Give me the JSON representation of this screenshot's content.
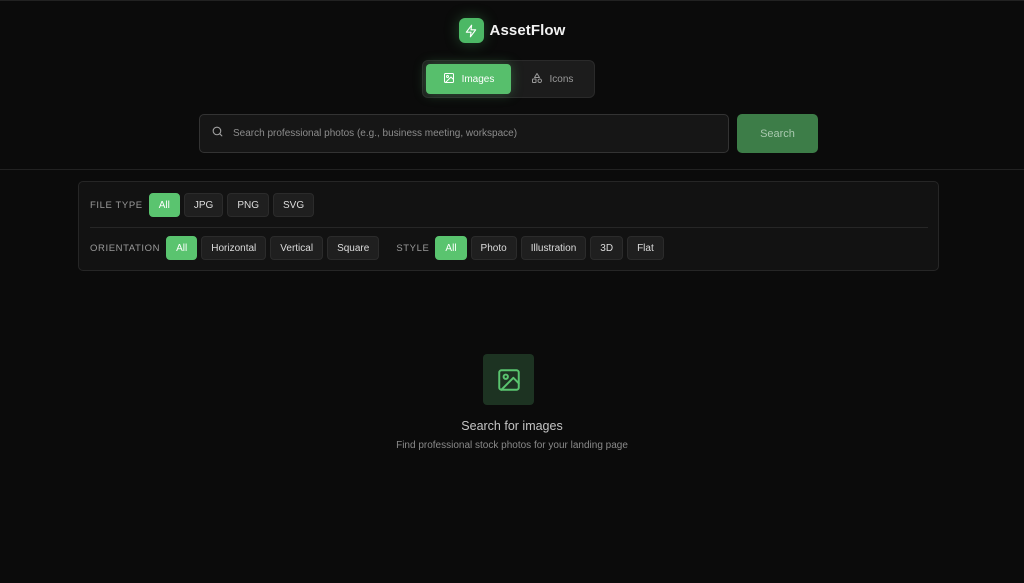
{
  "brand": {
    "name": "AssetFlow",
    "logo_icon": "lightning-icon",
    "accent": "#4cb865"
  },
  "mode_tabs": [
    {
      "label": "Images",
      "icon": "image-icon",
      "active": true
    },
    {
      "label": "Icons",
      "icon": "shapes-icon",
      "active": false
    }
  ],
  "search": {
    "placeholder": "Search professional photos (e.g., business meeting, workspace)",
    "value": "",
    "button_label": "Search",
    "icon": "search-icon"
  },
  "filters": {
    "file_type": {
      "label": "FILE TYPE",
      "options": [
        "All",
        "JPG",
        "PNG",
        "SVG"
      ],
      "selected": "All"
    },
    "orientation": {
      "label": "ORIENTATION",
      "options": [
        "All",
        "Horizontal",
        "Vertical",
        "Square"
      ],
      "selected": "All"
    },
    "style": {
      "label": "STYLE",
      "options": [
        "All",
        "Photo",
        "Illustration",
        "3D",
        "Flat"
      ],
      "selected": "All"
    }
  },
  "empty_state": {
    "icon": "image-icon",
    "title": "Search for images",
    "subtitle": "Find professional stock photos for your landing page"
  },
  "colors": {
    "background": "#0b0b0b",
    "accent": "#57bf6c",
    "search_button": "#3d7d48",
    "empty_icon_bg": "#1d3322"
  }
}
